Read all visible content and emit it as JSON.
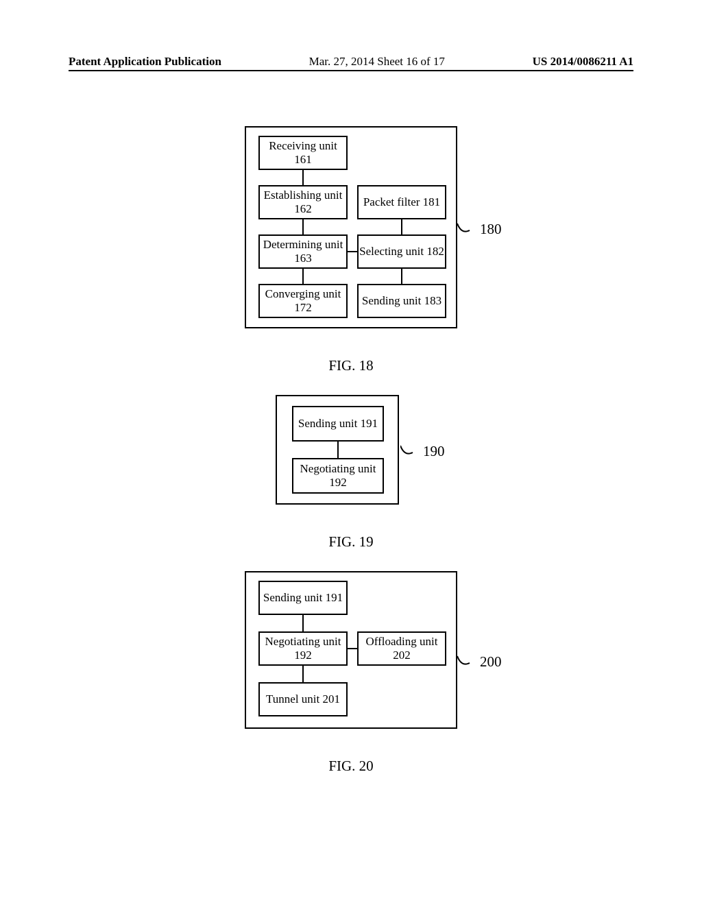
{
  "header": {
    "left": "Patent Application Publication",
    "mid": "Mar. 27, 2014  Sheet 16 of 17",
    "right": "US 2014/0086211 A1"
  },
  "fig18": {
    "ref": "180",
    "caption": "FIG. 18",
    "units": {
      "receiving": "Receiving unit 161",
      "establishing": "Establishing unit 162",
      "determining": "Determining unit 163",
      "converging": "Converging unit 172",
      "packetfilter": "Packet filter 181",
      "selecting": "Selecting unit 182",
      "sending": "Sending unit 183"
    }
  },
  "fig19": {
    "ref": "190",
    "caption": "FIG. 19",
    "units": {
      "sending": "Sending unit 191",
      "negotiating": "Negotiating unit 192"
    }
  },
  "fig20": {
    "ref": "200",
    "caption": "FIG. 20",
    "units": {
      "sending": "Sending unit 191",
      "negotiating": "Negotiating unit 192",
      "offloading": "Offloading unit 202",
      "tunnel": "Tunnel unit 201"
    }
  }
}
